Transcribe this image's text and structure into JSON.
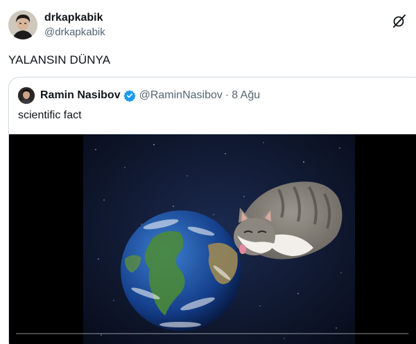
{
  "tweet": {
    "author_name": "drkapkabik",
    "author_handle": "@drkapkabik",
    "text": "YALANSIN DÜNYA"
  },
  "quote": {
    "author_name": "Ramin Nasibov",
    "author_handle": "@RaminNasibov",
    "separator": "·",
    "date": "8 Ağu",
    "text": "scientific fact",
    "verified_color": "#1d9bf0"
  },
  "media": {
    "type": "video",
    "progress": 0.0
  },
  "icons": {
    "top_right": "grok-slash-icon",
    "verified": "verified-badge-icon"
  }
}
